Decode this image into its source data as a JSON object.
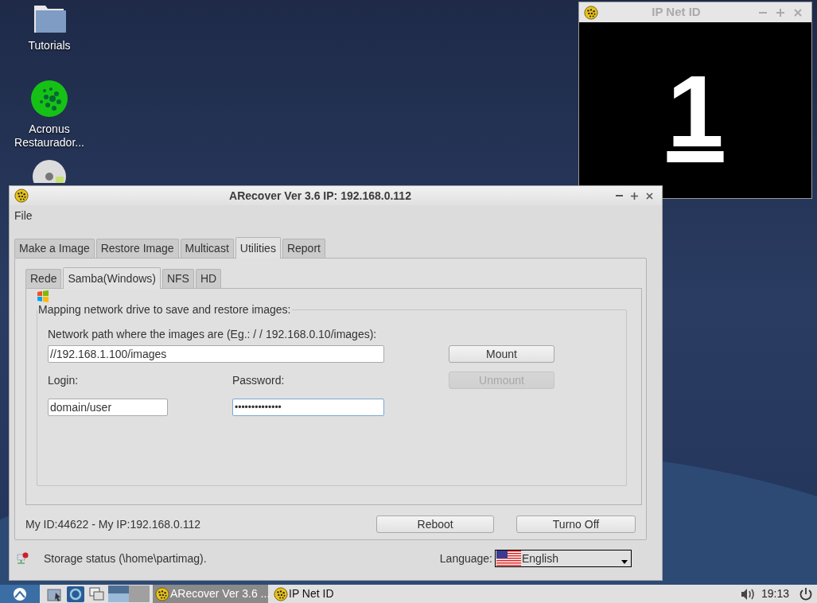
{
  "desktop_icons": [
    {
      "kind": "folder",
      "label": "Tutorials"
    },
    {
      "kind": "globe",
      "label": "Acronus Restaurador..."
    },
    {
      "kind": "disc"
    }
  ],
  "ip_window": {
    "title": "IP Net ID",
    "active": false,
    "id_number": "1"
  },
  "main_window": {
    "title": "ARecover Ver 3.6 IP: 192.168.0.112",
    "active": true,
    "menu": [
      "File"
    ],
    "tabs": [
      {
        "label": "Make a Image",
        "selected": false
      },
      {
        "label": "Restore Image",
        "selected": false
      },
      {
        "label": "Multicast",
        "selected": false
      },
      {
        "label": "Utilities",
        "selected": true
      },
      {
        "label": "Report",
        "selected": false
      }
    ],
    "subtabs": [
      {
        "label": "Rede",
        "selected": false
      },
      {
        "label": "Samba(Windows)",
        "selected": true
      },
      {
        "label": "NFS",
        "selected": false
      },
      {
        "label": "HD",
        "selected": false
      }
    ],
    "group": {
      "title": "Mapping network drive to save and restore images:",
      "path_label": "Network path where the images are (Eg.: / / 192.168.0.10/images):",
      "path_value": "//192.168.1.100/images",
      "login_label": "Login:",
      "login_value": "domain/user",
      "password_label": "Password:",
      "password_value": "••••••••••••••",
      "mount": {
        "label": "Mount",
        "disabled": false
      },
      "unmount": {
        "label": "Unmount",
        "disabled": true
      }
    },
    "id_text": "My ID:44622 - My IP:192.168.0.112",
    "reboot": "Reboot",
    "turn_off": "Turno Off",
    "storage_status": "Storage status (\\home\\partimag).",
    "language_label": "Language:",
    "language_value": "English"
  },
  "taskbar": {
    "tasks": [
      {
        "label": "ARecover Ver 3.6 ...",
        "selected": true
      },
      {
        "label": "IP Net ID",
        "selected": false
      }
    ],
    "clock": "19:13"
  }
}
